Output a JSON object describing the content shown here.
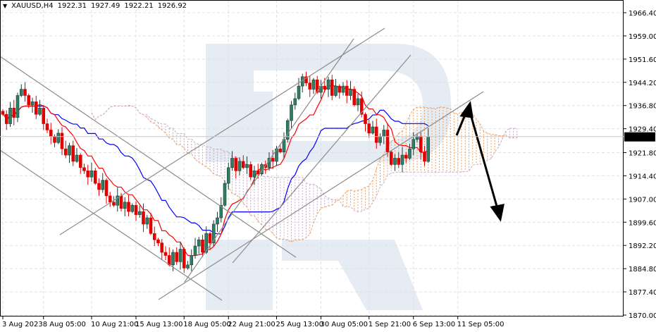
{
  "header": {
    "symbol": "XAUUSD,H4",
    "open": "1922.31",
    "high": "1927.49",
    "low": "1922.21",
    "close": "1926.92"
  },
  "chart_data": {
    "type": "candlestick",
    "title": "XAUUSD,H4",
    "indicators": [
      "Ichimoku (Tenkan-sen red, Kijun-sen blue, cloud dotted)"
    ],
    "ylim": [
      1870.0,
      1966.4
    ],
    "yticks": [
      "1966.40",
      "1959.00",
      "1951.60",
      "1944.20",
      "1936.80",
      "1929.40",
      "1921.80",
      "1914.40",
      "1907.00",
      "1899.60",
      "1892.20",
      "1884.80",
      "1877.40",
      "1870.00"
    ],
    "current_price": "1926.92",
    "xticks": [
      {
        "label": "3 Aug 2023",
        "index": 0
      },
      {
        "label": "8 Aug 05:00",
        "index": 11
      },
      {
        "label": "10 Aug 21:00",
        "index": 24
      },
      {
        "label": "15 Aug 13:00",
        "index": 36
      },
      {
        "label": "18 Aug 05:00",
        "index": 49
      },
      {
        "label": "22 Aug 21:00",
        "index": 61
      },
      {
        "label": "25 Aug 13:00",
        "index": 74
      },
      {
        "label": "30 Aug 05:00",
        "index": 86
      },
      {
        "label": "1 Sep 21:00",
        "index": 99
      },
      {
        "label": "6 Sep 13:00",
        "index": 111
      },
      {
        "label": "11 Sep 05:00",
        "index": 123
      }
    ],
    "closes": [
      1934,
      1931,
      1936,
      1933,
      1940,
      1942,
      1940,
      1937,
      1938,
      1934,
      1936,
      1931,
      1929,
      1927,
      1925,
      1928,
      1923,
      1921,
      1924,
      1919,
      1921,
      1917,
      1916,
      1914,
      1916,
      1912,
      1910,
      1913,
      1908,
      1906,
      1905,
      1908,
      1904,
      1906,
      1903,
      1905,
      1902,
      1903,
      1899,
      1901,
      1896,
      1894,
      1893,
      1890,
      1889,
      1886,
      1890,
      1887,
      1891,
      1885,
      1886,
      1889,
      1892,
      1894,
      1890,
      1896,
      1893,
      1899,
      1901,
      1905,
      1912,
      1917,
      1920,
      1916,
      1919,
      1917,
      1918,
      1914,
      1916,
      1915,
      1918,
      1917,
      1920,
      1919,
      1923,
      1922,
      1926,
      1932,
      1937,
      1939,
      1943,
      1946,
      1944,
      1942,
      1945,
      1941,
      1943,
      1942,
      1945,
      1940,
      1943,
      1941,
      1943,
      1940,
      1942,
      1937,
      1939,
      1934,
      1931,
      1928,
      1930,
      1925,
      1927,
      1929,
      1922,
      1918,
      1920,
      1918,
      1921,
      1920,
      1923,
      1926,
      1927,
      1922,
      1919,
      1926.92
    ],
    "forecast": "rise to ~1938 then decline toward ~1900",
    "colors": {
      "bull": "#2f7d64",
      "bear": "#e00000",
      "tenkan": "#ff0000",
      "kijun": "#0000ff",
      "spanA": "#f0a060",
      "spanB": "#c8a8c8",
      "trendline": "#8c8c8c",
      "arrow": "#000000"
    }
  }
}
